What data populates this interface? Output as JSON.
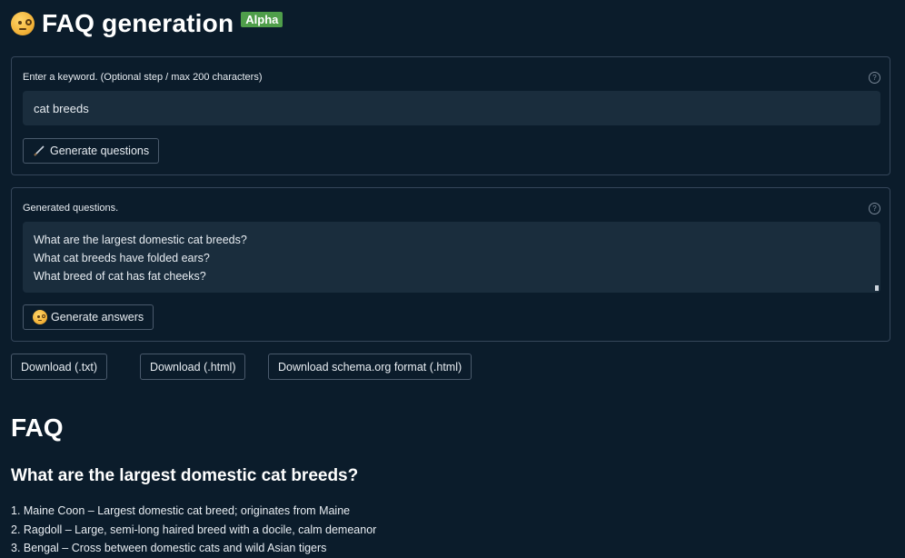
{
  "header": {
    "title": "FAQ generation",
    "badge": "Alpha"
  },
  "keyword_panel": {
    "label": "Enter a keyword. (Optional step / max 200 characters)",
    "value": "cat breeds",
    "help_icon": "?",
    "generate_button": "Generate questions"
  },
  "questions_panel": {
    "label": "Generated questions.",
    "help_icon": "?",
    "questions": [
      "What are the largest domestic cat breeds?",
      "What cat breeds have folded ears?",
      "What breed of cat has fat cheeks?"
    ],
    "generate_button": "Generate answers"
  },
  "downloads": [
    "Download (.txt)",
    "Download (.html)",
    "Download schema.org format (.html)"
  ],
  "faq": {
    "heading": "FAQ",
    "question": "What are the largest domestic cat breeds?",
    "answers": [
      "1. Maine Coon – Largest domestic cat breed; originates from Maine",
      "2. Ragdoll – Large, semi-long haired breed with a docile, calm demeanor",
      "3. Bengal – Cross between domestic cats and wild Asian tigers"
    ]
  },
  "colors": {
    "background": "#0b1c2b",
    "input_bg": "#1a2d3d",
    "badge": "#4f9e4a",
    "border": "#35465a"
  }
}
